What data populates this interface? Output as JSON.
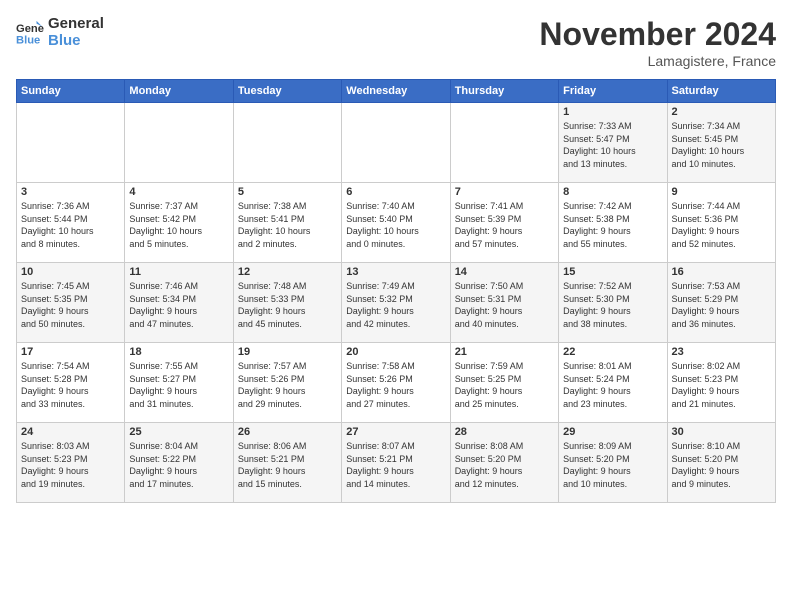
{
  "header": {
    "logo_line1": "General",
    "logo_line2": "Blue",
    "month_title": "November 2024",
    "location": "Lamagistere, France"
  },
  "days_of_week": [
    "Sunday",
    "Monday",
    "Tuesday",
    "Wednesday",
    "Thursday",
    "Friday",
    "Saturday"
  ],
  "weeks": [
    [
      {
        "day": "",
        "info": ""
      },
      {
        "day": "",
        "info": ""
      },
      {
        "day": "",
        "info": ""
      },
      {
        "day": "",
        "info": ""
      },
      {
        "day": "",
        "info": ""
      },
      {
        "day": "1",
        "info": "Sunrise: 7:33 AM\nSunset: 5:47 PM\nDaylight: 10 hours\nand 13 minutes."
      },
      {
        "day": "2",
        "info": "Sunrise: 7:34 AM\nSunset: 5:45 PM\nDaylight: 10 hours\nand 10 minutes."
      }
    ],
    [
      {
        "day": "3",
        "info": "Sunrise: 7:36 AM\nSunset: 5:44 PM\nDaylight: 10 hours\nand 8 minutes."
      },
      {
        "day": "4",
        "info": "Sunrise: 7:37 AM\nSunset: 5:42 PM\nDaylight: 10 hours\nand 5 minutes."
      },
      {
        "day": "5",
        "info": "Sunrise: 7:38 AM\nSunset: 5:41 PM\nDaylight: 10 hours\nand 2 minutes."
      },
      {
        "day": "6",
        "info": "Sunrise: 7:40 AM\nSunset: 5:40 PM\nDaylight: 10 hours\nand 0 minutes."
      },
      {
        "day": "7",
        "info": "Sunrise: 7:41 AM\nSunset: 5:39 PM\nDaylight: 9 hours\nand 57 minutes."
      },
      {
        "day": "8",
        "info": "Sunrise: 7:42 AM\nSunset: 5:38 PM\nDaylight: 9 hours\nand 55 minutes."
      },
      {
        "day": "9",
        "info": "Sunrise: 7:44 AM\nSunset: 5:36 PM\nDaylight: 9 hours\nand 52 minutes."
      }
    ],
    [
      {
        "day": "10",
        "info": "Sunrise: 7:45 AM\nSunset: 5:35 PM\nDaylight: 9 hours\nand 50 minutes."
      },
      {
        "day": "11",
        "info": "Sunrise: 7:46 AM\nSunset: 5:34 PM\nDaylight: 9 hours\nand 47 minutes."
      },
      {
        "day": "12",
        "info": "Sunrise: 7:48 AM\nSunset: 5:33 PM\nDaylight: 9 hours\nand 45 minutes."
      },
      {
        "day": "13",
        "info": "Sunrise: 7:49 AM\nSunset: 5:32 PM\nDaylight: 9 hours\nand 42 minutes."
      },
      {
        "day": "14",
        "info": "Sunrise: 7:50 AM\nSunset: 5:31 PM\nDaylight: 9 hours\nand 40 minutes."
      },
      {
        "day": "15",
        "info": "Sunrise: 7:52 AM\nSunset: 5:30 PM\nDaylight: 9 hours\nand 38 minutes."
      },
      {
        "day": "16",
        "info": "Sunrise: 7:53 AM\nSunset: 5:29 PM\nDaylight: 9 hours\nand 36 minutes."
      }
    ],
    [
      {
        "day": "17",
        "info": "Sunrise: 7:54 AM\nSunset: 5:28 PM\nDaylight: 9 hours\nand 33 minutes."
      },
      {
        "day": "18",
        "info": "Sunrise: 7:55 AM\nSunset: 5:27 PM\nDaylight: 9 hours\nand 31 minutes."
      },
      {
        "day": "19",
        "info": "Sunrise: 7:57 AM\nSunset: 5:26 PM\nDaylight: 9 hours\nand 29 minutes."
      },
      {
        "day": "20",
        "info": "Sunrise: 7:58 AM\nSunset: 5:26 PM\nDaylight: 9 hours\nand 27 minutes."
      },
      {
        "day": "21",
        "info": "Sunrise: 7:59 AM\nSunset: 5:25 PM\nDaylight: 9 hours\nand 25 minutes."
      },
      {
        "day": "22",
        "info": "Sunrise: 8:01 AM\nSunset: 5:24 PM\nDaylight: 9 hours\nand 23 minutes."
      },
      {
        "day": "23",
        "info": "Sunrise: 8:02 AM\nSunset: 5:23 PM\nDaylight: 9 hours\nand 21 minutes."
      }
    ],
    [
      {
        "day": "24",
        "info": "Sunrise: 8:03 AM\nSunset: 5:23 PM\nDaylight: 9 hours\nand 19 minutes."
      },
      {
        "day": "25",
        "info": "Sunrise: 8:04 AM\nSunset: 5:22 PM\nDaylight: 9 hours\nand 17 minutes."
      },
      {
        "day": "26",
        "info": "Sunrise: 8:06 AM\nSunset: 5:21 PM\nDaylight: 9 hours\nand 15 minutes."
      },
      {
        "day": "27",
        "info": "Sunrise: 8:07 AM\nSunset: 5:21 PM\nDaylight: 9 hours\nand 14 minutes."
      },
      {
        "day": "28",
        "info": "Sunrise: 8:08 AM\nSunset: 5:20 PM\nDaylight: 9 hours\nand 12 minutes."
      },
      {
        "day": "29",
        "info": "Sunrise: 8:09 AM\nSunset: 5:20 PM\nDaylight: 9 hours\nand 10 minutes."
      },
      {
        "day": "30",
        "info": "Sunrise: 8:10 AM\nSunset: 5:20 PM\nDaylight: 9 hours\nand 9 minutes."
      }
    ]
  ]
}
